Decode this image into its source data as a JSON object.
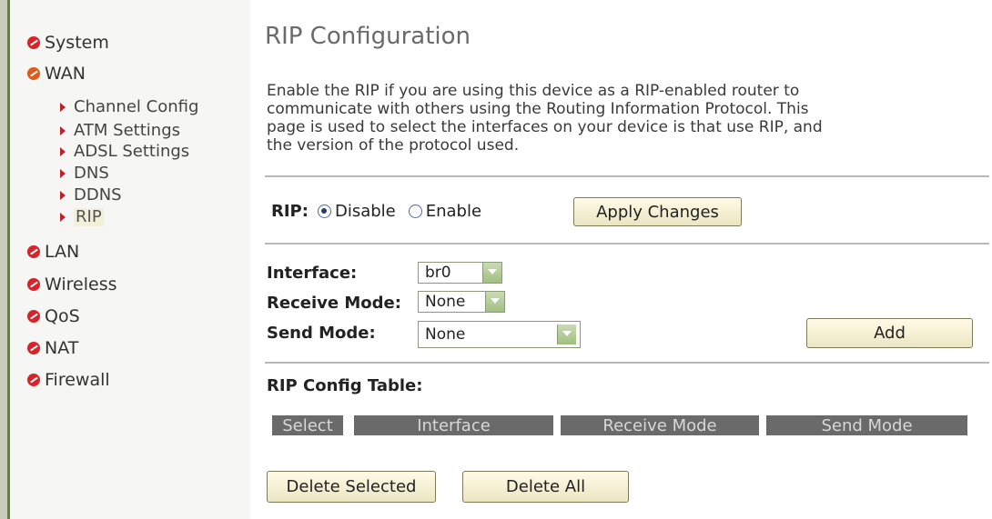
{
  "sidebar": {
    "items": [
      {
        "label": "System"
      },
      {
        "label": "WAN"
      },
      {
        "label": "LAN"
      },
      {
        "label": "Wireless"
      },
      {
        "label": "QoS"
      },
      {
        "label": "NAT"
      },
      {
        "label": "Firewall"
      }
    ],
    "wan_sub": [
      {
        "label": "Channel Config"
      },
      {
        "label": "ATM Settings"
      },
      {
        "label": "ADSL Settings"
      },
      {
        "label": "DNS"
      },
      {
        "label": "DDNS"
      },
      {
        "label": "RIP"
      }
    ]
  },
  "page": {
    "title": "RIP Configuration",
    "description_lines": [
      "Enable the RIP if you are using this device as a RIP-enabled router to",
      "communicate with others using the Routing Information Protocol. This",
      "page is used to select the interfaces on your device is that use RIP, and",
      "the version of the protocol used."
    ]
  },
  "rip": {
    "label": "RIP:",
    "disable_label": "Disable",
    "enable_label": "Enable",
    "selected": "Disable",
    "apply_button": "Apply Changes"
  },
  "form": {
    "interface_label": "Interface:",
    "interface_value": "br0",
    "receive_mode_label": "Receive Mode:",
    "receive_mode_value": "None",
    "send_mode_label": "Send Mode:",
    "send_mode_value": "None",
    "add_button": "Add"
  },
  "table": {
    "title": "RIP Config Table:",
    "columns": [
      "Select",
      "Interface",
      "Receive Mode",
      "Send Mode"
    ],
    "delete_selected_button": "Delete Selected",
    "delete_all_button": "Delete All"
  }
}
